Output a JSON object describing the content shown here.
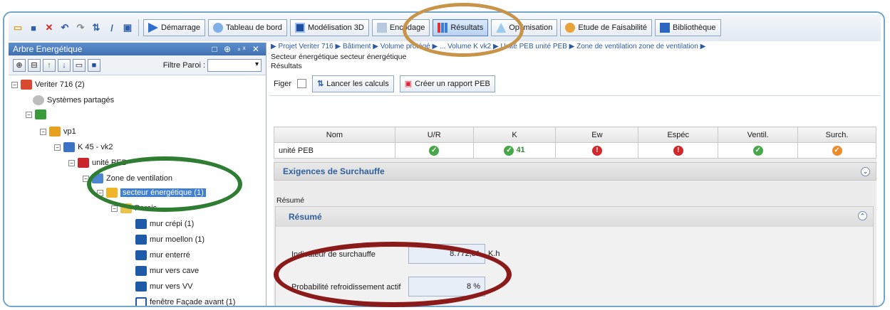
{
  "toolbar": {
    "quick_icons": [
      "folder-icon",
      "save-icon",
      "delete-icon",
      "undo-icon",
      "redo-icon",
      "refresh-icon",
      "pen-icon",
      "window-icon"
    ],
    "buttons": [
      {
        "label": "Démarrage",
        "icon": "play-icon"
      },
      {
        "label": "Tableau de bord",
        "icon": "dashboard-icon"
      },
      {
        "label": "Modélisation 3D",
        "icon": "model-3d-icon"
      },
      {
        "label": "Encodage",
        "icon": "encode-icon"
      },
      {
        "label": "Résultats",
        "icon": "bar-chart-icon",
        "active": true
      },
      {
        "label": "Optimisation",
        "icon": "optimize-icon"
      },
      {
        "label": "Etude de Faisabilité",
        "icon": "feasibility-icon"
      },
      {
        "label": "Bibliothèque",
        "icon": "library-icon"
      }
    ]
  },
  "left_panel": {
    "title": "Arbre Energétique",
    "title_controls": "□ ⊕ ▫ˣ ✕",
    "filter_label": "Filtre Paroi :",
    "tree": [
      {
        "label": "Veriter 716 (2)",
        "level": 0,
        "color": "#d9492f"
      },
      {
        "label": "Systèmes partagés",
        "level": 1,
        "color": "#9a9a9a"
      },
      {
        "label": "",
        "level": 1,
        "color": "#3a9a3a"
      },
      {
        "label": "vp1",
        "level": 2,
        "color": "#e6a21f"
      },
      {
        "label": "K 45 - vk2",
        "level": 3,
        "color": "#3b74c4"
      },
      {
        "label": "unité PEB",
        "level": 4,
        "color": "#c9252b"
      },
      {
        "label": "Zone de ventilation",
        "level": 5,
        "color": "#4d86cf"
      },
      {
        "label": "secteur énergétique (1)",
        "level": 6,
        "color": "#f0b62a",
        "selected": true
      },
      {
        "label": "Parois",
        "level": 7,
        "color": "#e8c24a"
      },
      {
        "label": "mur crépi (1)",
        "level": 8,
        "color": "#1f5aa8"
      },
      {
        "label": "mur moellon (1)",
        "level": 8,
        "color": "#1f5aa8"
      },
      {
        "label": "mur enterré",
        "level": 8,
        "color": "#1f5aa8"
      },
      {
        "label": "mur vers cave",
        "level": 8,
        "color": "#1f5aa8"
      },
      {
        "label": "mur vers VV",
        "level": 8,
        "color": "#1f5aa8"
      },
      {
        "label": "fenêtre Façade avant (1)",
        "level": 8,
        "color": "#ffffff"
      }
    ]
  },
  "right_panel": {
    "breadcrumb": "▶ Projet Veriter 716 ▶ Bâtiment ▶ Volume protégé ▶ ... Volume K vk2 ▶ Unité PEB unité PEB ▶ Zone de ventilation zone de ventilation ▶",
    "subtitle": "Secteur énergétique secteur énergétique",
    "results_label": "Résultats",
    "figer_label": "Figer",
    "launch_button": "Lancer les calculs",
    "report_button": "Créer un rapport PEB",
    "table": {
      "headers": [
        "Nom",
        "U/R",
        "K",
        "Ew",
        "Espéc",
        "Ventil.",
        "Surch."
      ],
      "rows": [
        {
          "name": "unité PEB",
          "ur": "ok",
          "k": "ok",
          "k_value": "41",
          "ew": "err",
          "espec": "err",
          "ventil": "ok",
          "surch": "warn"
        }
      ]
    },
    "section_title": "Exigences de Surchauffe",
    "resume_small": "Résumé",
    "resume_header": "Résumé",
    "fields": [
      {
        "label": "Indicateur de surchauffe",
        "value": "8.772,31",
        "unit": "K.h"
      },
      {
        "label": "Probabilité refroidissement actif",
        "value": "8 %",
        "unit": ""
      }
    ]
  },
  "annotations": {
    "tan": "#c8944a",
    "green": "#2e7d32",
    "red": "#8b1a1a"
  }
}
